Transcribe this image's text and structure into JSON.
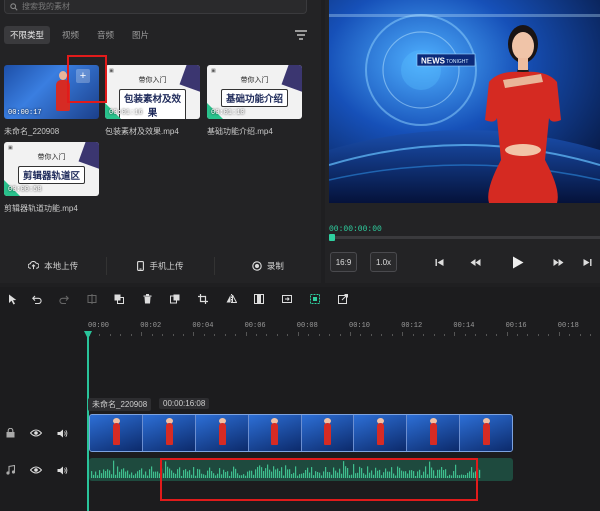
{
  "search": {
    "placeholder": "搜索我的素材"
  },
  "media_tabs": [
    {
      "label": "不限类型",
      "active": true
    },
    {
      "label": "视频"
    },
    {
      "label": "音频"
    },
    {
      "label": "图片"
    }
  ],
  "media_items": [
    {
      "name": "未命名_220908",
      "duration": "00:00:17",
      "kind": "news"
    },
    {
      "name": "包装素材及效果.mp4",
      "duration": "00:01:16",
      "kind": "promo",
      "line1": "带你入门",
      "line2": "包装素材及效果"
    },
    {
      "name": "基础功能介绍.mp4",
      "duration": "00:01:10",
      "kind": "promo",
      "line1": "带你入门",
      "line2": "基础功能介绍"
    },
    {
      "name": "剪辑器轨道功能.mp4",
      "duration": "00:00:58",
      "kind": "promo",
      "line1": "带你入门",
      "line2": "剪辑器轨道区"
    }
  ],
  "upload_bar": {
    "local": "本地上传",
    "phone": "手机上传",
    "record": "录制"
  },
  "preview": {
    "news_brand": "NEWS",
    "news_sub": "TONIGHT",
    "current_time": "00:00:00:00",
    "aspect": "16:9",
    "speed": "1.0x",
    "progress": 0
  },
  "timeline": {
    "ticks": [
      "00:00",
      "00:02",
      "00:04",
      "00:06",
      "00:08",
      "00:10",
      "00:12",
      "00:14",
      "00:16",
      "00:18"
    ],
    "clip_name": "未命名_220908",
    "clip_duration": "00:00:16:08"
  },
  "colors": {
    "accent": "#2fd0a0",
    "highlight": "#e11b1b",
    "panel": "#232325"
  }
}
